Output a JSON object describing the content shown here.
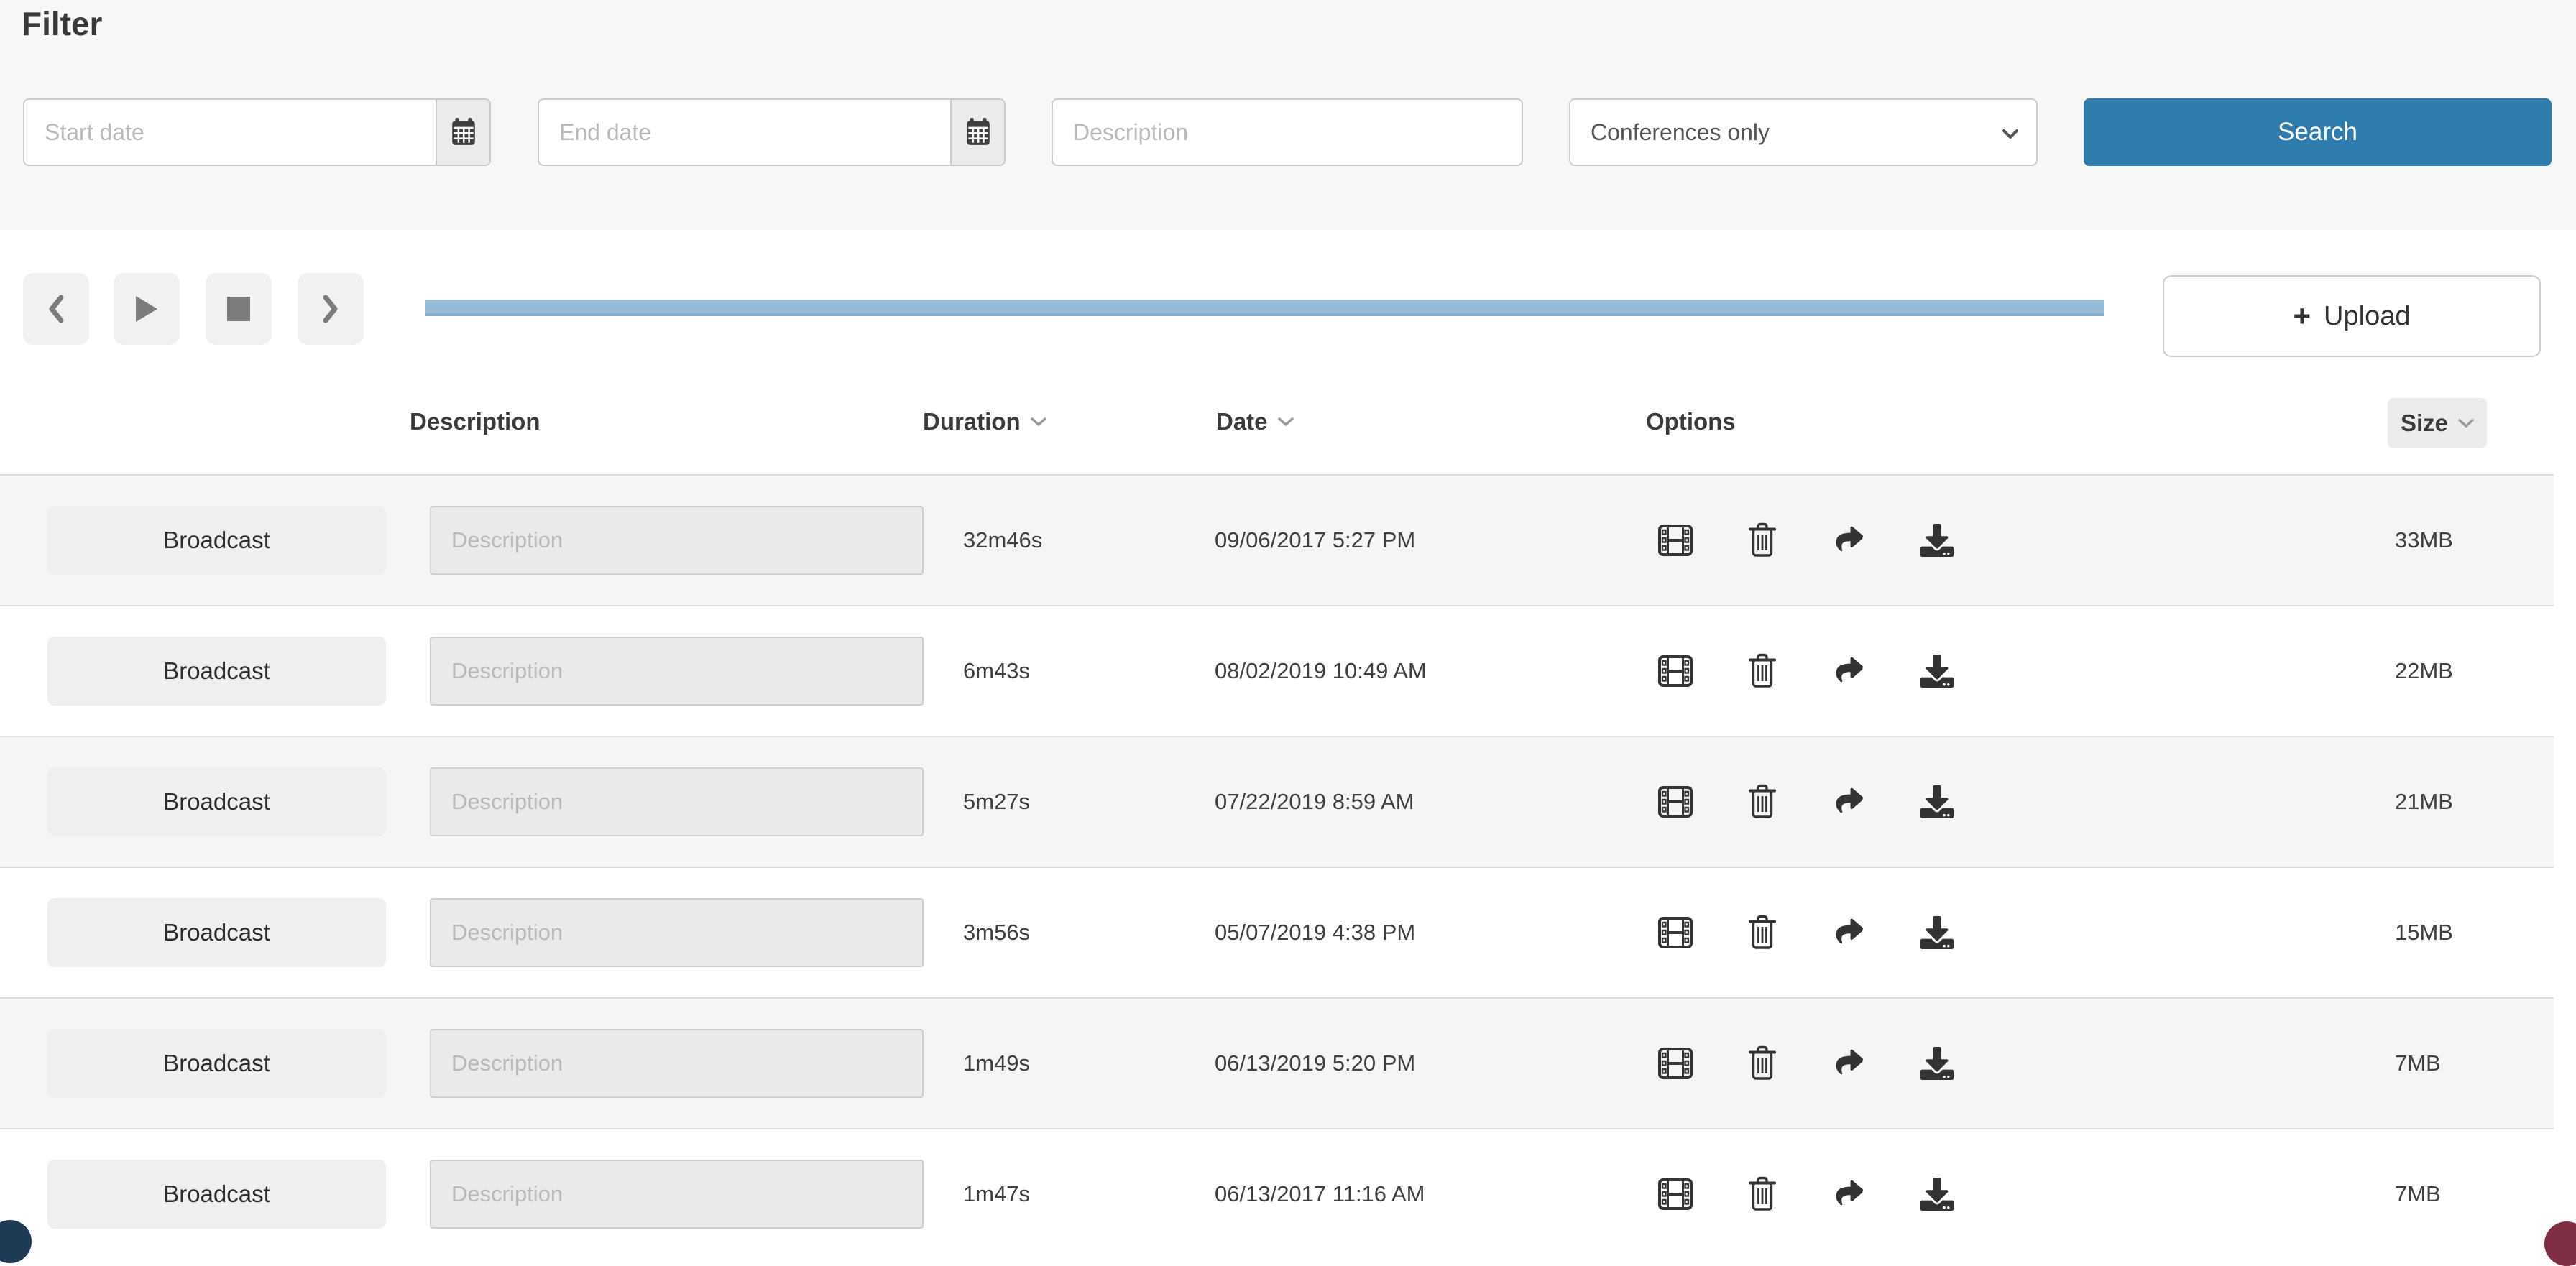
{
  "filter": {
    "title": "Filter",
    "start_date": {
      "placeholder": "Start date",
      "value": ""
    },
    "end_date": {
      "placeholder": "End date",
      "value": ""
    },
    "description": {
      "placeholder": "Description",
      "value": ""
    },
    "type_select": {
      "selected": "Conferences only"
    },
    "search_button": "Search"
  },
  "toolbar": {
    "upload_plus": "+",
    "upload_label": "Upload"
  },
  "table": {
    "headers": {
      "description": "Description",
      "duration": "Duration",
      "date": "Date",
      "options": "Options",
      "size": "Size"
    },
    "rows": [
      {
        "type_label": "Broadcast",
        "description_placeholder": "Description",
        "duration": "32m46s",
        "date": "09/06/2017 5:27 PM",
        "size": "33MB"
      },
      {
        "type_label": "Broadcast",
        "description_placeholder": "Description",
        "duration": "6m43s",
        "date": "08/02/2019 10:49 AM",
        "size": "22MB"
      },
      {
        "type_label": "Broadcast",
        "description_placeholder": "Description",
        "duration": "5m27s",
        "date": "07/22/2019 8:59 AM",
        "size": "21MB"
      },
      {
        "type_label": "Broadcast",
        "description_placeholder": "Description",
        "duration": "3m56s",
        "date": "05/07/2019 4:38 PM",
        "size": "15MB"
      },
      {
        "type_label": "Broadcast",
        "description_placeholder": "Description",
        "duration": "1m49s",
        "date": "06/13/2019 5:20 PM",
        "size": "7MB"
      },
      {
        "type_label": "Broadcast",
        "description_placeholder": "Description",
        "duration": "1m47s",
        "date": "06/13/2017 11:16 AM",
        "size": "7MB"
      }
    ]
  },
  "colors": {
    "accent_blue": "#2e7bae",
    "progress_blue": "#97b9d8",
    "progress_blue_edge": "#85aacc",
    "filter_bg": "#f7f7f7",
    "row_stripe": "#f5f5f5"
  }
}
